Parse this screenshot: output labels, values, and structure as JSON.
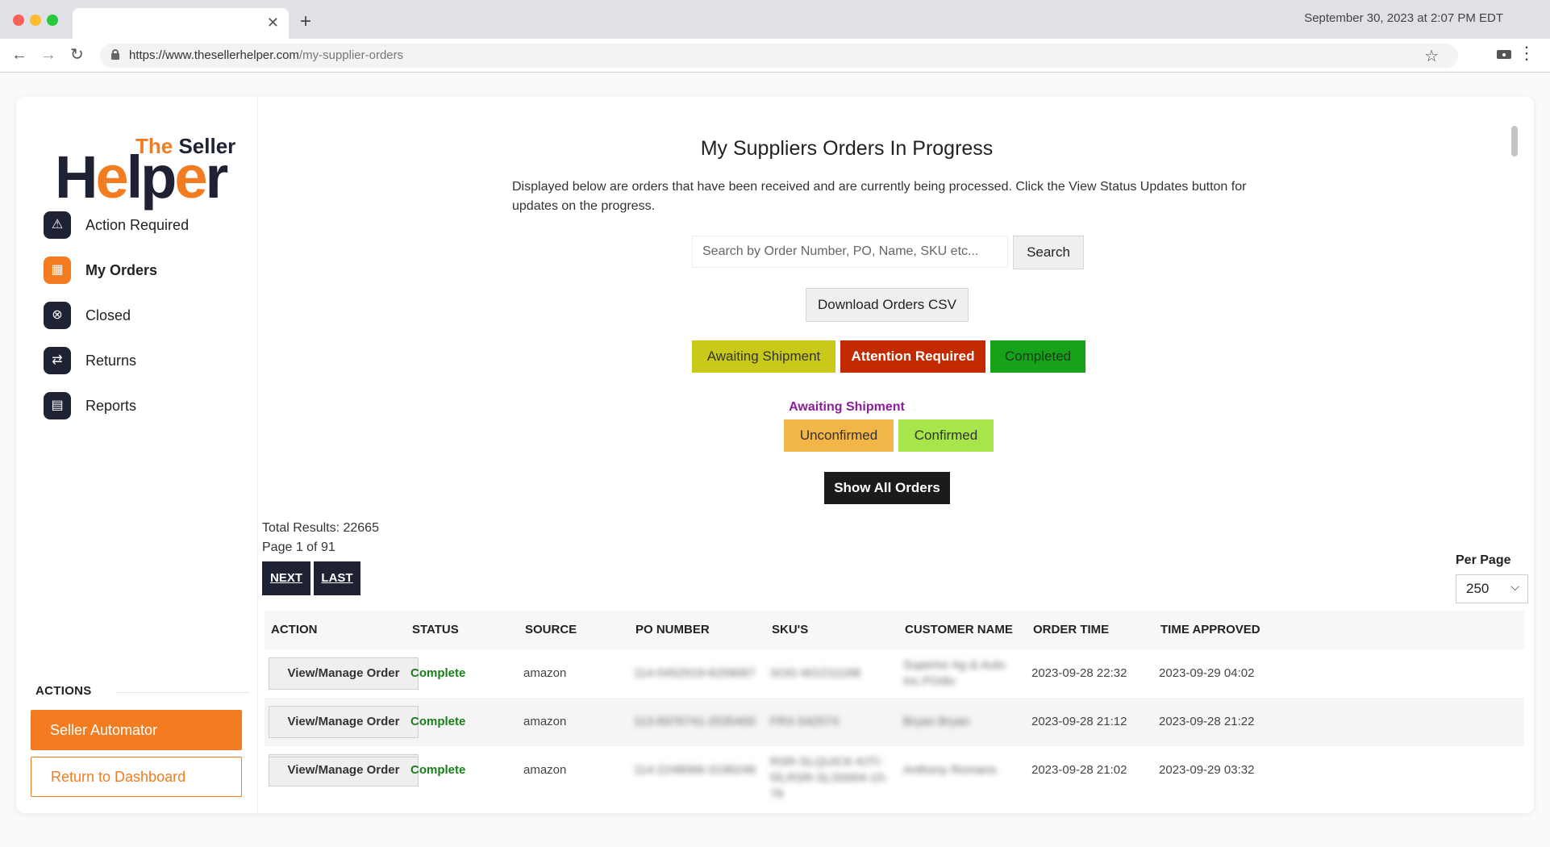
{
  "browser": {
    "datetime": "September 30, 2023 at 2:07 PM EDT",
    "url_host": "https://www.thesellerhelper.com",
    "url_path": "/my-supplier-orders"
  },
  "logo": {
    "small_text_1": "The",
    "small_text_2": " Seller",
    "big_text_1": "H",
    "big_text_2": "e",
    "big_text_3": "lp",
    "big_text_4": "e",
    "big_text_5": "r"
  },
  "sidebar": {
    "items": [
      {
        "label": "Action Required",
        "icon": "warning-icon"
      },
      {
        "label": "My Orders",
        "icon": "boxes-icon"
      },
      {
        "label": "Closed",
        "icon": "close-circle-icon"
      },
      {
        "label": "Returns",
        "icon": "swap-arrows-icon"
      },
      {
        "label": "Reports",
        "icon": "report-icon"
      }
    ],
    "actions_title": "ACTIONS",
    "seller_automator": "Seller Automator",
    "return_dashboard": "Return to Dashboard"
  },
  "main": {
    "title": "My Suppliers Orders In Progress",
    "description": "Displayed below are orders that have been received and are currently being processed. Click the View Status Updates button for updates on the progress.",
    "search_placeholder": "Search by Order Number, PO, Name, SKU etc...",
    "search_button": "Search",
    "csv_button": "Download Orders CSV",
    "filters": {
      "awaiting": "Awaiting Shipment",
      "attention": "Attention Required",
      "completed": "Completed"
    },
    "sub_title": "Awaiting Shipment",
    "sub_filters": {
      "unconfirmed": "Unconfirmed",
      "confirmed": "Confirmed"
    },
    "show_all": "Show All Orders",
    "total_results": "Total Results: 22665",
    "page_info": "Page 1 of 91",
    "next": "NEXT",
    "last": "LAST",
    "per_page_label": "Per Page",
    "per_page_value": "250"
  },
  "table": {
    "columns": [
      "ACTION",
      "STATUS",
      "SOURCE",
      "PO NUMBER",
      "SKU'S",
      "CUSTOMER NAME",
      "ORDER TIME",
      "TIME APPROVED"
    ],
    "rows": [
      {
        "action": "View/Manage Order",
        "status": "Complete",
        "source": "amazon",
        "po": "114-0452919-6209067",
        "sku": "SOG-W1O11168",
        "customer": "Superior Ag & Auto Inc.POdiv",
        "order_time": "2023-09-28 22:32",
        "approved": "2023-09-29 04:02"
      },
      {
        "action": "View/Manage Order",
        "status": "Complete",
        "source": "amazon",
        "po": "113-6976741-2535400",
        "sku": "FRX-542574",
        "customer": "Bryan Bryan",
        "order_time": "2023-09-28 21:12",
        "approved": "2023-09-28 21:22"
      },
      {
        "action": "View/Manage Order",
        "status": "Complete",
        "source": "amazon",
        "po": "114-2248066-3196248",
        "sku": "RSR-SLQUICK-KITI-55,RSR-SLS0004-15-76",
        "customer": "Anthony Romano",
        "order_time": "2023-09-28 21:02",
        "approved": "2023-09-29 03:32"
      }
    ]
  }
}
